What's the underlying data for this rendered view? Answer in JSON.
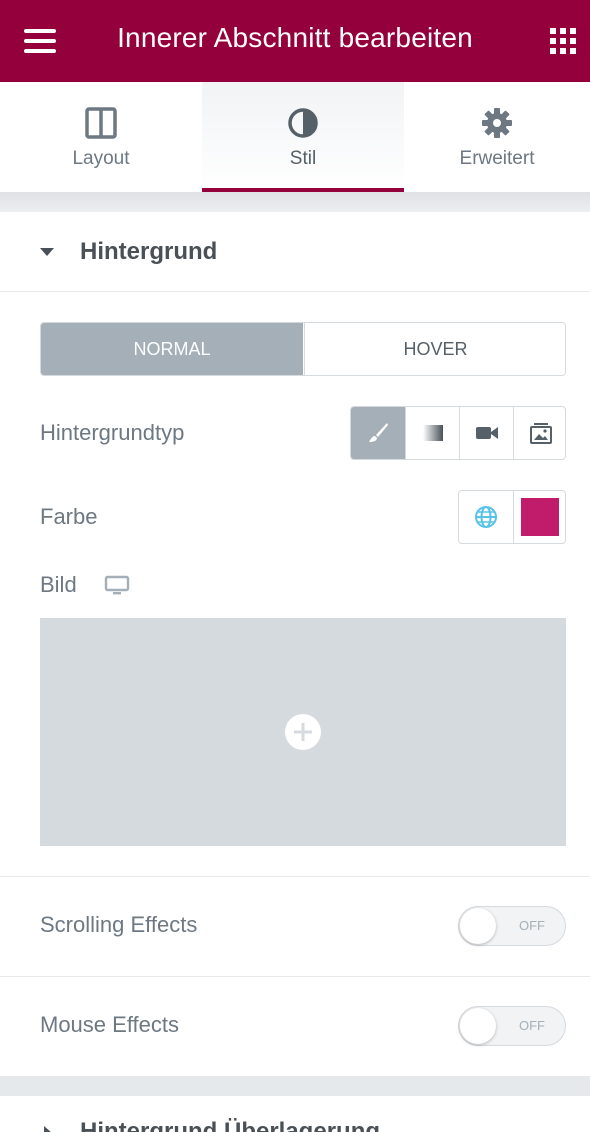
{
  "header": {
    "title": "Innerer Abschnitt bearbeiten",
    "menu_icon": "hamburger-icon",
    "apps_icon": "grid-icon",
    "color": "#93003c"
  },
  "tabs": [
    {
      "label": "Layout",
      "icon": "columns-icon",
      "active": false
    },
    {
      "label": "Stil",
      "icon": "half-circle-icon",
      "active": true
    },
    {
      "label": "Erweitert",
      "icon": "gear-icon",
      "active": false
    }
  ],
  "section": {
    "title": "Hintergrund",
    "state_tabs": {
      "normal": "NORMAL",
      "hover": "HOVER",
      "selected": "NORMAL"
    },
    "type_label": "Hintergrundtyp",
    "type_options": [
      "brush-icon",
      "gradient-icon",
      "video-icon",
      "slideshow-icon"
    ],
    "color_label": "Farbe",
    "color_value": "#c11b6b",
    "image_label": "Bild",
    "image_icon": "monitor-icon"
  },
  "effects": [
    {
      "label": "Scrolling Effects",
      "state": "OFF"
    },
    {
      "label": "Mouse Effects",
      "state": "OFF"
    }
  ],
  "next_section": {
    "title": "Hintergrund Überlagerung"
  }
}
